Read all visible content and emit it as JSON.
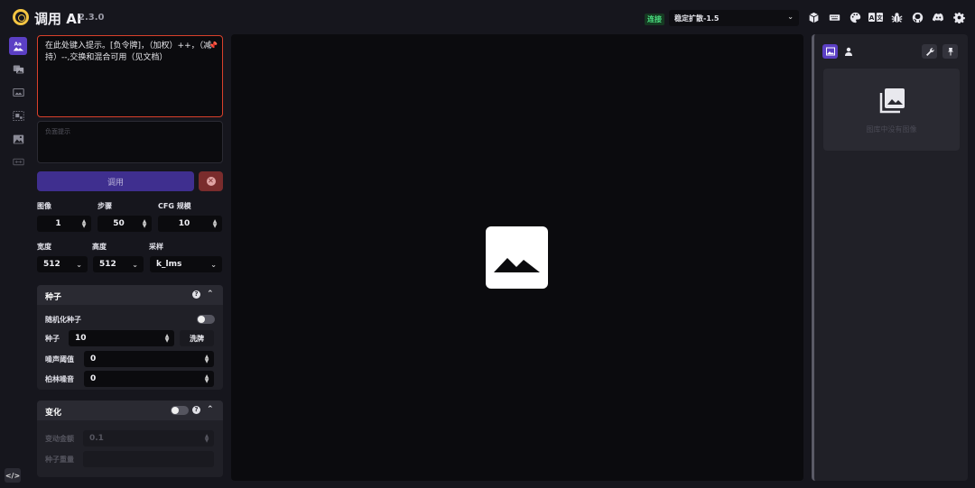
{
  "app": {
    "title": "调用 AI",
    "version": "2.3.0"
  },
  "header": {
    "status": "连接",
    "model": "稳定扩散-1.5",
    "icons": [
      "cube-icon",
      "keyboard-icon",
      "palette-icon",
      "translate-icon",
      "bug-icon",
      "github-icon",
      "discord-icon",
      "gear-icon"
    ]
  },
  "nav": {
    "items": [
      "text-to-image",
      "image-to-image",
      "inpainting",
      "outpainting",
      "nodes",
      "postprocessing"
    ],
    "dev_label": "</>"
  },
  "prompt": {
    "value": "在此处键入提示。[负令牌]，（加权）++，（减持）--,交换和混合可用（见文档）",
    "negative_placeholder": "负面提示"
  },
  "actions": {
    "invoke": "调用",
    "cancel": "✕"
  },
  "options": {
    "images": {
      "label": "图像",
      "value": "1"
    },
    "steps": {
      "label": "步骤",
      "value": "50"
    },
    "cfg": {
      "label": "CFG 规模",
      "value": "10"
    },
    "width": {
      "label": "宽度",
      "value": "512"
    },
    "height": {
      "label": "高度",
      "value": "512"
    },
    "sampler": {
      "label": "采样",
      "value": "k_lms"
    }
  },
  "seed_panel": {
    "title": "种子",
    "random_label": "随机化种子",
    "seed_label": "种子",
    "seed_value": "10",
    "shuffle": "洗牌",
    "threshold_label": "噪声阈值",
    "threshold_value": "0",
    "perlin_label": "柏林噪音",
    "perlin_value": "0"
  },
  "variation_panel": {
    "title": "变化",
    "amount_label": "变动金额",
    "amount_value": "0.1",
    "weights_label": "种子重量"
  },
  "gallery": {
    "empty_text": "图库中没有图像"
  }
}
